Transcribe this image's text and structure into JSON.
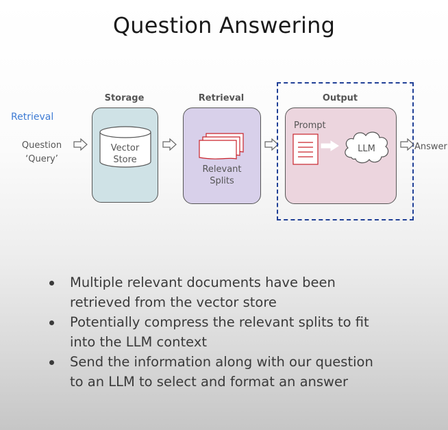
{
  "title": "Question Answering",
  "side_label": "Retrieval",
  "question": {
    "line1": "Question",
    "line2": "‘Query’"
  },
  "stages": {
    "storage": {
      "heading": "Storage",
      "item_line1": "Vector",
      "item_line2": "Store"
    },
    "retrieval": {
      "heading": "Retrieval",
      "item_line1": "Relevant",
      "item_line2": "Splits"
    },
    "output": {
      "heading": "Output",
      "prompt_label": "Prompt",
      "llm_label": "LLM"
    }
  },
  "answer": "Answer",
  "bullets": [
    {
      "line1": "Multiple relevant documents have been",
      "line2": "retrieved from the vector store"
    },
    {
      "line1": "Potentially compress the relevant splits to fit",
      "line2": "into the LLM context"
    },
    {
      "line1": "Send the information along with our question",
      "line2": "to an LLM to select and format an answer"
    }
  ],
  "colors": {
    "storage_fill": "#cfe2e6",
    "retrieval_fill": "#d8d0ea",
    "output_fill": "#ecd5de",
    "highlight_border": "#1f3f96",
    "side_label": "#3d7bd4",
    "document_red": "#c9232b"
  }
}
